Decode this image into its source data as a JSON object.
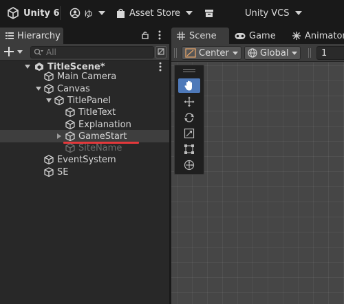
{
  "topbar": {
    "app_title": "Unity 6",
    "account_label": "ゆ",
    "asset_store_label": "Asset Store",
    "vcs_label": "Unity VCS"
  },
  "hierarchy": {
    "tab_label": "Hierarchy",
    "search_placeholder": "All",
    "scene_name": "TitleScene*",
    "items": [
      {
        "label": "Main Camera"
      },
      {
        "label": "Canvas"
      },
      {
        "label": "TitlePanel"
      },
      {
        "label": "TitleText"
      },
      {
        "label": "Explanation"
      },
      {
        "label": "GameStart"
      },
      {
        "label": "SiteName"
      },
      {
        "label": "EventSystem"
      },
      {
        "label": "SE"
      }
    ]
  },
  "scene_view": {
    "tabs": [
      {
        "label": "Scene"
      },
      {
        "label": "Game"
      },
      {
        "label": "Animator"
      }
    ],
    "pivot_label": "Center",
    "space_label": "Global",
    "snap_value": "1",
    "tools": [
      "hand-tool-icon",
      "move-tool-icon",
      "rotate-tool-icon",
      "scale-tool-icon",
      "rect-tool-icon",
      "transform-tool-icon"
    ],
    "active_tool": "hand-tool-icon"
  },
  "colors": {
    "selection_blue": "#4e79b9",
    "annotation_red": "#e5383b"
  }
}
